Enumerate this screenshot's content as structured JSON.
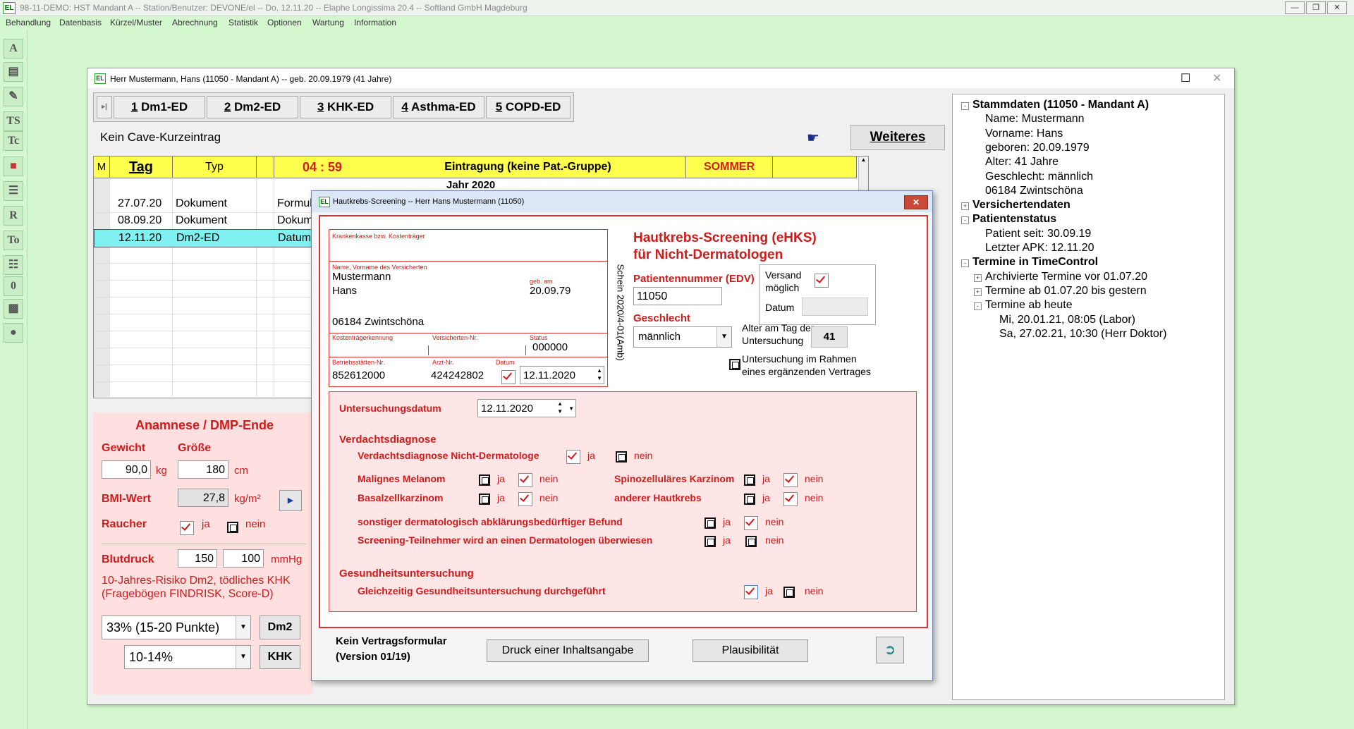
{
  "app": {
    "title": "98-11-DEMO: HST Mandant A -- Station/Benutzer: DEVONE/el -- Do, 12.11.20 -- Elaphe Longissima 20.4 -- Softland GmbH Magdeburg",
    "logo": "EL",
    "menu": [
      "Behandlung",
      "Datenbasis",
      "Kürzel/Muster",
      "Abrechnung",
      "Statistik",
      "Optionen",
      "Wartung",
      "Information"
    ],
    "left_toolbar": [
      "A",
      "",
      "",
      "TS",
      "Tc",
      "",
      "",
      "R",
      "To",
      "",
      "0",
      "",
      ""
    ]
  },
  "patient_window": {
    "title": "Herr Mustermann, Hans (11050 - Mandant A) -- geb. 20.09.1979 (41 Jahre)",
    "tabs": [
      {
        "key": "1",
        "label": "Dm1-ED"
      },
      {
        "key": "2",
        "label": "Dm2-ED"
      },
      {
        "key": "3",
        "label": "KHK-ED"
      },
      {
        "key": "4",
        "label": "Asthma-ED"
      },
      {
        "key": "5",
        "label": "COPD-ED"
      }
    ],
    "cave": "Kein Cave-Kurzeintrag",
    "weiteres": "Weiteres",
    "journal": {
      "headers": {
        "m": "M",
        "tag": "Tag",
        "typ": "Typ",
        "time": "04 : 59",
        "entry": "Eintragung (keine Pat.-Gruppe)",
        "season": "SOMMER"
      },
      "year": "Jahr 2020",
      "rows": [
        {
          "date": "27.07.20",
          "type": "Dokument",
          "form": "Formula"
        },
        {
          "date": "08.09.20",
          "type": "Dokument",
          "form": "Dokum"
        },
        {
          "date": "12.11.20",
          "type": "Dm2-ED",
          "form": "Datum"
        }
      ]
    },
    "anamnese": {
      "title": "Anamnese / DMP-Ende",
      "gewicht_label": "Gewicht",
      "groesse_label": "Größe",
      "gewicht": "90,0",
      "gewicht_unit": "kg",
      "groesse": "180",
      "groesse_unit": "cm",
      "bmi_label": "BMI-Wert",
      "bmi": "27,8",
      "bmi_unit": "kg/m²",
      "raucher_label": "Raucher",
      "ja": "ja",
      "nein": "nein",
      "blutdruck_label": "Blutdruck",
      "bp_sys": "150",
      "bp_dia": "100",
      "bp_unit": "mmHg",
      "risk_text_1": "10-Jahres-Risiko Dm2, tödliches KHK",
      "risk_text_2": "(Fragebögen FINDRISK, Score-D)",
      "dm2_value": "33% (15-20 Punkte)",
      "dm2_btn": "Dm2",
      "khk_value": "10-14%",
      "khk_btn": "KHK"
    }
  },
  "tree": {
    "items": [
      {
        "label": "Stammdaten (11050 - Mandant A)",
        "bold": true,
        "exp": "-"
      },
      {
        "label": "Name: Mustermann"
      },
      {
        "label": "Vorname: Hans"
      },
      {
        "label": "geboren: 20.09.1979"
      },
      {
        "label": "Alter: 41 Jahre"
      },
      {
        "label": "Geschlecht: männlich"
      },
      {
        "label": "06184 Zwintschöna"
      },
      {
        "label": "Versichertendaten",
        "bold": true,
        "exp": "+"
      },
      {
        "label": "Patientenstatus",
        "bold": true,
        "exp": "-"
      },
      {
        "label": "Patient seit: 30.09.19"
      },
      {
        "label": "Letzter APK: 12.11.20"
      },
      {
        "label": "Termine in TimeControl",
        "bold": true,
        "exp": "-"
      },
      {
        "label": "Archivierte Termine vor 01.07.20",
        "exp": "+"
      },
      {
        "label": "Termine ab 01.07.20 bis gestern",
        "exp": "+"
      },
      {
        "label": "Termine ab heute",
        "exp": "-"
      },
      {
        "label": "Mi, 20.01.21, 08:05 (Labor)"
      },
      {
        "label": "Sa, 27.02.21, 10:30 (Herr Doktor)"
      }
    ]
  },
  "dialog": {
    "title": "Hautkrebs-Screening -- Herr Hans Mustermann (11050)",
    "close": "✕",
    "form": {
      "kasse_label": "Krankenkasse bzw. Kostenträger",
      "name_label": "Name, Vorname des Versicherten",
      "nachname": "Mustermann",
      "vorname": "Hans",
      "geb_label": "geb. am",
      "geb": "20.09.79",
      "ort": "06184 Zwintschöna",
      "ktk_label": "Kostenträgerkennung",
      "vnr_label": "Versicherten-Nr.",
      "status_label": "Status",
      "status": "000000",
      "bsnr_label": "Betriebsstätten-Nr.",
      "bsnr": "852612000",
      "arzt_label": "Arzt-Nr.",
      "arzt": "424242802",
      "datum_label": "Datum",
      "datum": "12.11.2020",
      "schein": "Schein  2020/4-01(Amb)"
    },
    "heading_1": "Hautkrebs-Screening (eHKS)",
    "heading_2": "für Nicht-Dermatologen",
    "patnr_label": "Patientennummer (EDV)",
    "patnr": "11050",
    "versand_label_1": "Versand",
    "versand_label_2": "möglich",
    "versand_datum_label": "Datum",
    "geschlecht_label": "Geschlecht",
    "geschlecht": "männlich",
    "alter_label_1": "Alter am Tag der",
    "alter_label_2": "Untersuchung",
    "alter": "41",
    "vertrag_1": "Untersuchung im Rahmen",
    "vertrag_2": "eines ergänzenden Vertrages",
    "untersuchungsdatum_label": "Untersuchungsdatum",
    "untersuchungsdatum": "12.11.2020",
    "verdacht_title": "Verdachtsdiagnose",
    "verdacht_nd": "Verdachtsdiagnose Nicht-Dermatologe",
    "melanom": "Malignes Melanom",
    "basal": "Basalzellkarzinom",
    "spino": "Spinozelluläres Karzinom",
    "anderer": "anderer Hautkrebs",
    "sonstiger": "sonstiger dermatologisch abklärungsbedürftiger Befund",
    "ueberwiesen": "Screening-Teilnehmer wird an einen Dermatologen überwiesen",
    "gu_title": "Gesundheitsuntersuchung",
    "gu_text": "Gleichzeitig Gesundheitsuntersuchung durchgeführt",
    "ja": "ja",
    "nein": "nein",
    "footer_1": "Kein Vertragsformular",
    "footer_2": "(Version 01/19)",
    "druck_btn": "Druck einer Inhaltsangabe",
    "plaus_btn": "Plausibilität"
  }
}
